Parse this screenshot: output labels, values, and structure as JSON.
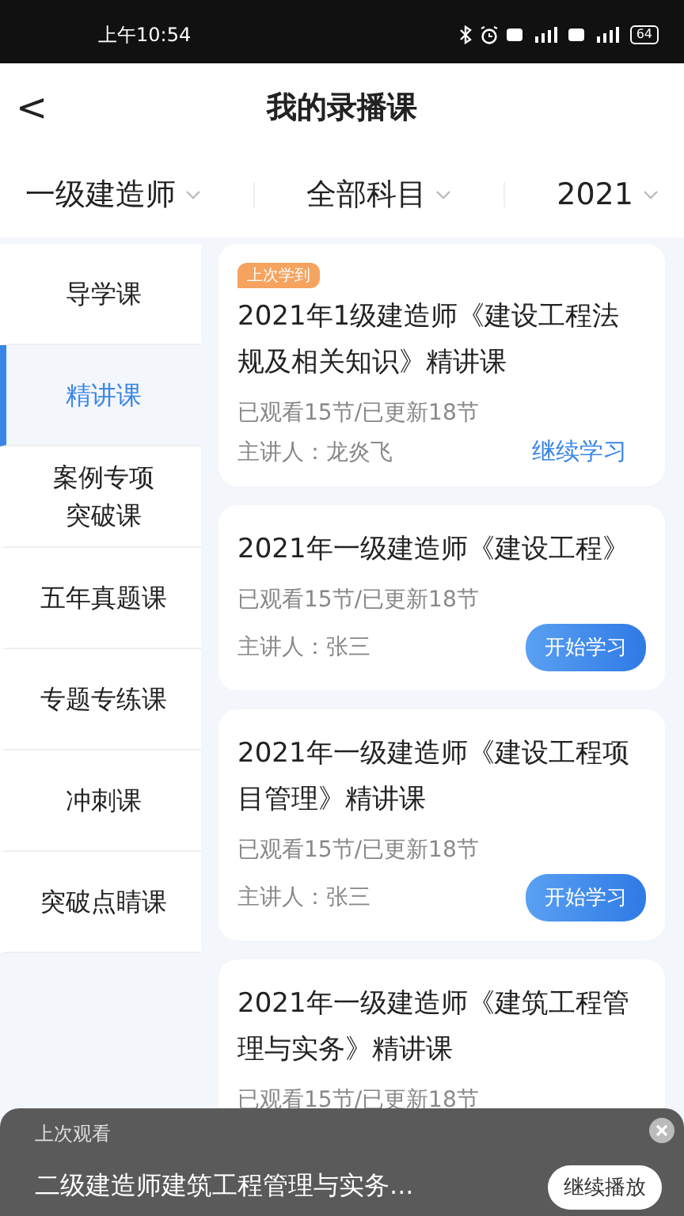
{
  "status_bar": {
    "time": "上午10:54",
    "battery": "64"
  },
  "header": {
    "back": "<",
    "title": "我的录播课"
  },
  "filters": [
    {
      "label": "一级建造师"
    },
    {
      "label": "全部科目"
    },
    {
      "label": "2021"
    }
  ],
  "sidebar": {
    "items": [
      {
        "label": "导学课",
        "selected": false
      },
      {
        "label": "精讲课",
        "selected": true
      },
      {
        "label": "案例专项突破课",
        "selected": false
      },
      {
        "label": "五年真题课",
        "selected": false
      },
      {
        "label": "专题专练课",
        "selected": false
      },
      {
        "label": "冲刺课",
        "selected": false
      },
      {
        "label": "突破点睛课",
        "selected": false
      }
    ]
  },
  "courses": [
    {
      "badge": "上次学到",
      "title": "2021年1级建造师《建设工程法规及相关知识》精讲课",
      "progress": "已观看15节/已更新18节",
      "lecturer": "主讲人：龙炎飞",
      "action": {
        "kind": "link",
        "label": "继续学习"
      }
    },
    {
      "title": "2021年一级建造师《建设工程》",
      "progress": "已观看15节/已更新18节",
      "lecturer": "主讲人：张三",
      "action": {
        "kind": "button",
        "label": "开始学习"
      }
    },
    {
      "title": "2021年一级建造师《建设工程项目管理》精讲课",
      "progress": "已观看15节/已更新18节",
      "lecturer": "主讲人：张三",
      "action": {
        "kind": "button",
        "label": "开始学习"
      }
    },
    {
      "title": "2021年一级建造师《建筑工程管理与实务》精讲课",
      "progress": "已观看15节/已更新18节"
    }
  ],
  "resume_bar": {
    "caption": "上次观看",
    "title": "二级建造师建筑工程管理与实务...",
    "button": "继续播放"
  }
}
